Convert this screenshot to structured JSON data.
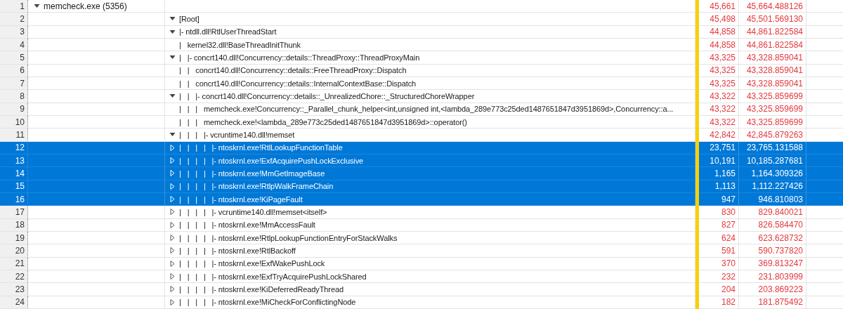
{
  "table": {
    "rows": [
      {
        "row_number": "1",
        "process": "memcheck.exe (5356)",
        "kind": "expandable",
        "expanded": true,
        "selected": false,
        "count": "45,661",
        "weight": "45,664.488126",
        "children": [
          {
            "row_number": "2",
            "stack": "[Root]",
            "kind": "expandable",
            "expanded": true,
            "selected": false,
            "count": "45,498",
            "weight": "45,501.569130",
            "children": [
              {
                "row_number": "3",
                "stack": "|- ntdll.dll!RtlUserThreadStart",
                "kind": "expandable",
                "expanded": true,
                "selected": false,
                "count": "44,858",
                "weight": "44,861.822584",
                "children": [
                  {
                    "row_number": "4",
                    "stack": "|   kernel32.dll!BaseThreadInitThunk",
                    "kind": "frame",
                    "selected": false,
                    "count": "44,858",
                    "weight": "44,861.822584"
                  },
                  {
                    "row_number": "5",
                    "stack": "|   |- concrt140.dll!Concurrency::details::ThreadProxy::ThreadProxyMain",
                    "kind": "expandable",
                    "expanded": true,
                    "selected": false,
                    "count": "43,325",
                    "weight": "43,328.859041",
                    "children": [
                      {
                        "row_number": "6",
                        "stack": "|   |   concrt140.dll!Concurrency::details::FreeThreadProxy::Dispatch",
                        "kind": "frame",
                        "selected": false,
                        "count": "43,325",
                        "weight": "43,328.859041"
                      },
                      {
                        "row_number": "7",
                        "stack": "|   |   concrt140.dll!Concurrency::details::InternalContextBase::Dispatch",
                        "kind": "frame",
                        "selected": false,
                        "count": "43,325",
                        "weight": "43,328.859041"
                      },
                      {
                        "row_number": "8",
                        "stack": "|   |   |- concrt140.dll!Concurrency::details::_UnrealizedChore::_StructuredChoreWrapper",
                        "kind": "expandable",
                        "expanded": true,
                        "selected": false,
                        "count": "43,322",
                        "weight": "43,325.859699",
                        "children": [
                          {
                            "row_number": "9",
                            "stack": "|   |   |   memcheck.exe!Concurrency::_Parallel_chunk_helper<int,unsigned int,<lambda_289e773c25ded1487651847d3951869d>,Concurrency::a...",
                            "kind": "frame",
                            "selected": false,
                            "count": "43,322",
                            "weight": "43,325.859699"
                          },
                          {
                            "row_number": "10",
                            "stack": "|   |   |   memcheck.exe!<lambda_289e773c25ded1487651847d3951869d>::operator()",
                            "kind": "frame",
                            "selected": false,
                            "count": "43,322",
                            "weight": "43,325.859699"
                          },
                          {
                            "row_number": "11",
                            "stack": "|   |   |   |- vcruntime140.dll!memset",
                            "kind": "expandable",
                            "expanded": true,
                            "selected": false,
                            "count": "42,842",
                            "weight": "42,845.879263",
                            "children": [
                              {
                                "row_number": "12",
                                "stack": "|   |   |   |   |- ntoskrnl.exe!RtlLookupFunctionTable",
                                "kind": "expandable",
                                "expanded": false,
                                "selected": true,
                                "count": "23,751",
                                "weight": "23,765.131588"
                              },
                              {
                                "row_number": "13",
                                "stack": "|   |   |   |   |- ntoskrnl.exe!ExfAcquirePushLockExclusive",
                                "kind": "expandable",
                                "expanded": false,
                                "selected": true,
                                "count": "10,191",
                                "weight": "10,185.287681"
                              },
                              {
                                "row_number": "14",
                                "stack": "|   |   |   |   |- ntoskrnl.exe!MmGetImageBase",
                                "kind": "expandable",
                                "expanded": false,
                                "selected": true,
                                "count": "1,165",
                                "weight": "1,164.309326"
                              },
                              {
                                "row_number": "15",
                                "stack": "|   |   |   |   |- ntoskrnl.exe!RtlpWalkFrameChain",
                                "kind": "expandable",
                                "expanded": false,
                                "selected": true,
                                "count": "1,113",
                                "weight": "1,112.227426"
                              },
                              {
                                "row_number": "16",
                                "stack": "|   |   |   |   |- ntoskrnl.exe!KiPageFault",
                                "kind": "expandable",
                                "expanded": false,
                                "selected": true,
                                "count": "947",
                                "weight": "946.810803"
                              },
                              {
                                "row_number": "17",
                                "stack": "|   |   |   |   |- vcruntime140.dll!memset<itself>",
                                "kind": "expandable",
                                "expanded": false,
                                "selected": false,
                                "count": "830",
                                "weight": "829.840021"
                              },
                              {
                                "row_number": "18",
                                "stack": "|   |   |   |   |- ntoskrnl.exe!MmAccessFault",
                                "kind": "expandable",
                                "expanded": false,
                                "selected": false,
                                "count": "827",
                                "weight": "826.584470"
                              },
                              {
                                "row_number": "19",
                                "stack": "|   |   |   |   |- ntoskrnl.exe!RtlpLookupFunctionEntryForStackWalks",
                                "kind": "expandable",
                                "expanded": false,
                                "selected": false,
                                "count": "624",
                                "weight": "623.628732"
                              },
                              {
                                "row_number": "20",
                                "stack": "|   |   |   |   |- ntoskrnl.exe!RtlBackoff",
                                "kind": "expandable",
                                "expanded": false,
                                "selected": false,
                                "count": "591",
                                "weight": "590.737820"
                              },
                              {
                                "row_number": "21",
                                "stack": "|   |   |   |   |- ntoskrnl.exe!ExfWakePushLock",
                                "kind": "expandable",
                                "expanded": false,
                                "selected": false,
                                "count": "370",
                                "weight": "369.813247"
                              },
                              {
                                "row_number": "22",
                                "stack": "|   |   |   |   |- ntoskrnl.exe!ExfTryAcquirePushLockShared",
                                "kind": "expandable",
                                "expanded": false,
                                "selected": false,
                                "count": "232",
                                "weight": "231.803999"
                              },
                              {
                                "row_number": "23",
                                "stack": "|   |   |   |   |- ntoskrnl.exe!KiDeferredReadyThread",
                                "kind": "expandable",
                                "expanded": false,
                                "selected": false,
                                "count": "204",
                                "weight": "203.869223"
                              },
                              {
                                "row_number": "24",
                                "stack": "|   |   |   |   |- ntoskrnl.exe!MiCheckForConflictingNode",
                                "kind": "expandable",
                                "expanded": false,
                                "selected": false,
                                "count": "182",
                                "weight": "181.875492"
                              }
                            ]
                          }
                        ]
                      }
                    ]
                  }
                ]
              }
            ]
          }
        ]
      }
    ]
  }
}
